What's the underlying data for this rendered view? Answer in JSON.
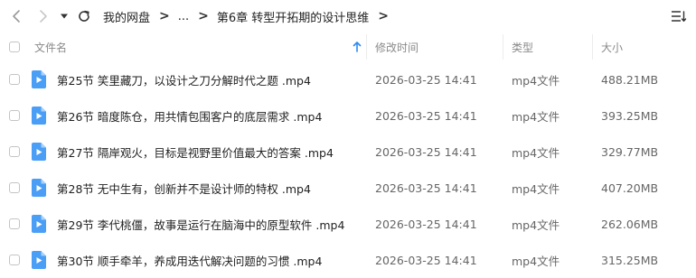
{
  "breadcrumb": {
    "root": "我的网盘",
    "ellipsis": "...",
    "current": "第6章 转型开拓期的设计思维"
  },
  "table": {
    "columns": {
      "name": "文件名",
      "modified": "修改时间",
      "type": "类型",
      "size": "大小"
    },
    "rows": [
      {
        "name": "第25节 笑里藏刀，以设计之刀分解时代之题 .mp4",
        "modified": "2026-03-25 14:41",
        "type": "mp4文件",
        "size": "488.21MB"
      },
      {
        "name": "第26节 暗度陈仓，用共情包围客户的底层需求 .mp4",
        "modified": "2026-03-25 14:41",
        "type": "mp4文件",
        "size": "393.25MB"
      },
      {
        "name": "第27节 隔岸观火，目标是视野里价值最大的答案 .mp4",
        "modified": "2026-03-25 14:41",
        "type": "mp4文件",
        "size": "329.77MB"
      },
      {
        "name": "第28节 无中生有，创新并不是设计师的特权 .mp4",
        "modified": "2026-03-25 14:41",
        "type": "mp4文件",
        "size": "407.20MB"
      },
      {
        "name": "第29节 李代桃僵，故事是运行在脑海中的原型软件 .mp4",
        "modified": "2026-03-25 14:41",
        "type": "mp4文件",
        "size": "262.06MB"
      },
      {
        "name": "第30节 顺手牵羊，养成用迭代解决问题的习惯 .mp4",
        "modified": "2026-03-25 14:41",
        "type": "mp4文件",
        "size": "315.25MB"
      }
    ]
  },
  "icons": {
    "back": "chevron-left-icon",
    "forward": "chevron-right-icon",
    "history": "caret-down-icon",
    "refresh": "refresh-icon",
    "sort": "sort-list-icon",
    "file": "video-file-icon",
    "sort_indicator": "arrow-up-icon"
  },
  "colors": {
    "accent": "#2b8cf0",
    "file_icon": "#4a9ef5"
  }
}
